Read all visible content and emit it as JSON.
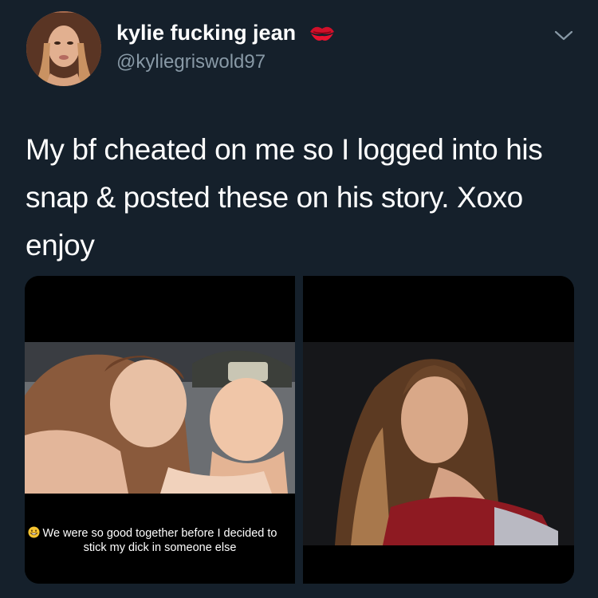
{
  "tweet": {
    "display_name": "kylie fucking jean",
    "handle": "@kyliegriswold97",
    "text": "My bf cheated on me so I logged into his snap & posted these on his story. Xoxo enjoy"
  },
  "media": {
    "left_photo_caption_line1": "We were so good together before I decided to",
    "left_photo_caption_line2": "stick my dick in someone else"
  },
  "icons": {
    "name_emoji": "kiss-mark-icon",
    "menu": "chevron-down-icon",
    "caption_emoji": "grinning-face-icon"
  },
  "colors": {
    "background": "#15202b",
    "secondary_text": "#8899a6"
  }
}
